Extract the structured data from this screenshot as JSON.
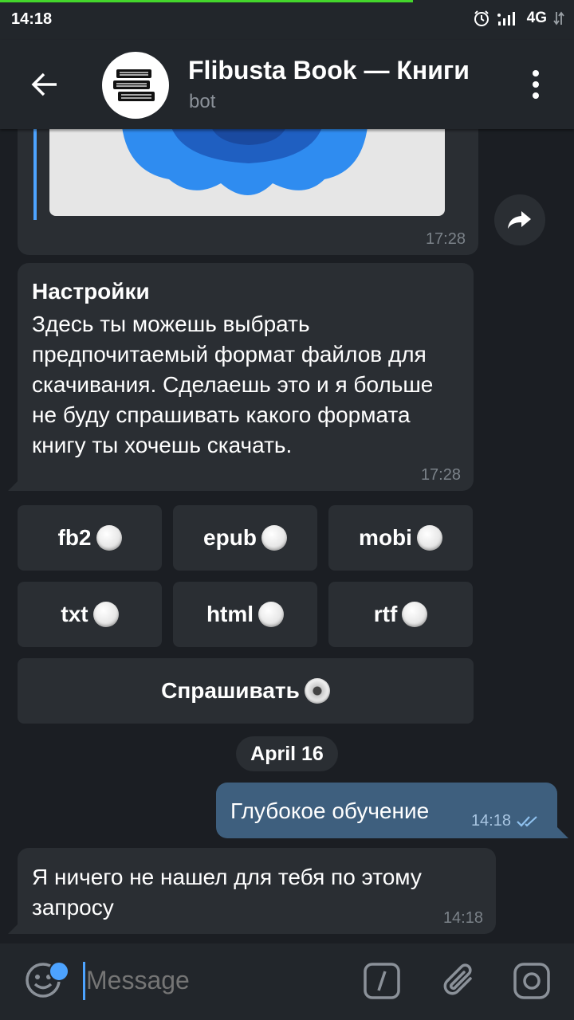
{
  "status": {
    "time": "14:18",
    "network": "4G"
  },
  "header": {
    "title": "Flibusta Book — Книги",
    "subtitle": "bot"
  },
  "messages": {
    "image_post": {
      "time": "17:28"
    },
    "settings": {
      "title": "Настройки",
      "body": "Здесь ты можешь выбрать предпочитаемый формат файлов для скачивания. Сделаешь это и я больше не буду спрашивать какого формата книгу ты хочешь скачать.",
      "time": "17:28"
    },
    "keyboard": {
      "buttons": [
        "fb2",
        "epub",
        "mobi",
        "txt",
        "html",
        "rtf"
      ],
      "ask": "Спрашивать"
    },
    "date_separator": "April 16",
    "outgoing": {
      "text": "Глубокое обучение",
      "time": "14:18"
    },
    "reply": {
      "text": "Я ничего не нашел для тебя по этому запросу",
      "time": "14:18"
    }
  },
  "input": {
    "placeholder": "Message"
  },
  "colors": {
    "accent": "#4da3ff",
    "bubble_in": "#2a2e33",
    "bubble_out": "#3e5f7e",
    "background": "#1b1e23"
  },
  "icons": [
    "back-arrow-icon",
    "book-stack-icon",
    "more-vert-icon",
    "share-icon",
    "emoji-icon",
    "slash-command-icon",
    "attach-icon",
    "camera-icon"
  ]
}
